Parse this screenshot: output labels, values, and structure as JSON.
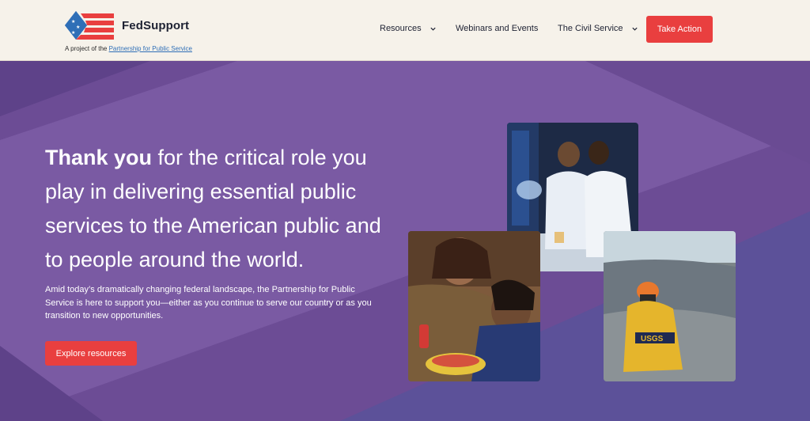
{
  "header": {
    "brand": "FedSupport",
    "tagline_prefix": "A project of the ",
    "tagline_link": "Partnership for Public Service",
    "nav": {
      "resources": "Resources",
      "webinars": "Webinars and Events",
      "civil_service": "The Civil Service"
    },
    "cta_label": "Take Action"
  },
  "hero": {
    "headline_bold": "Thank you",
    "headline_rest": " for the critical role you play in delivering essential public services to the American public and to people around the world.",
    "subtext": "Amid today’s dramatically changing federal landscape, the Partnership for Public Service is here to support you—either as you continue to serve our country or as you transition to new opportunities.",
    "button_label": "Explore resources",
    "photo_badge": "USGS"
  },
  "colors": {
    "accent": "#e93f3f",
    "hero_bg": "#6a4b93",
    "header_bg": "#f6f2ea"
  },
  "icons": [
    "flag-logo-icon",
    "chevron-down-icon"
  ]
}
